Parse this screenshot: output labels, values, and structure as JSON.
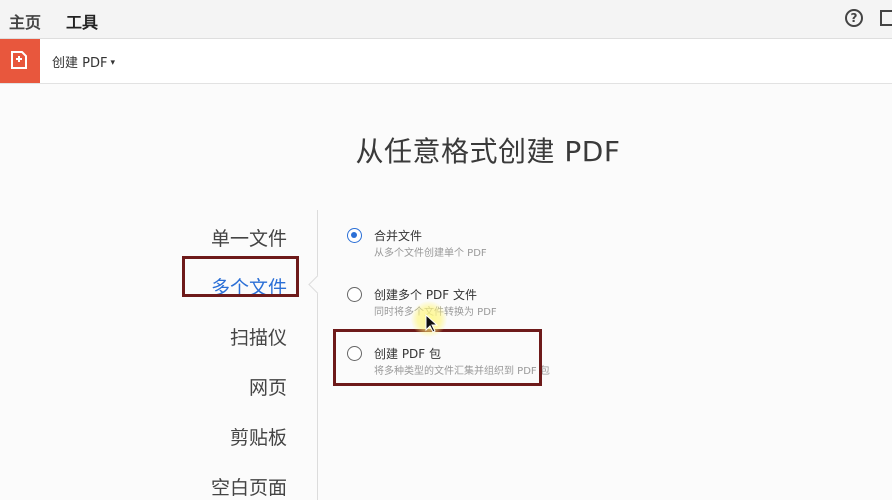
{
  "top_nav": {
    "tabs": [
      {
        "label": "主页"
      },
      {
        "label": "工具"
      }
    ],
    "help_icon": "?"
  },
  "toolbar": {
    "tool_icon": "create-pdf-icon",
    "tool_name": "创建 PDF",
    "caret": "▾"
  },
  "main": {
    "title": "从任意格式创建 PDF",
    "categories": [
      {
        "label": "单一文件"
      },
      {
        "label": "多个文件",
        "active": true
      },
      {
        "label": "扫描仪"
      },
      {
        "label": "网页"
      },
      {
        "label": "剪贴板"
      },
      {
        "label": "空白页面"
      }
    ],
    "options": [
      {
        "title": "合并文件",
        "desc": "从多个文件创建单个 PDF",
        "checked": true
      },
      {
        "title": "创建多个 PDF 文件",
        "desc": "同时将多个文件转换为 PDF",
        "checked": false
      },
      {
        "title": "创建 PDF 包",
        "desc": "将多种类型的文件汇集并组织到 PDF 包",
        "checked": false
      }
    ]
  },
  "colors": {
    "accent": "#2b6fd6",
    "tool_icon_bg": "#e8573d",
    "highlight_box": "#6e1a1a"
  }
}
